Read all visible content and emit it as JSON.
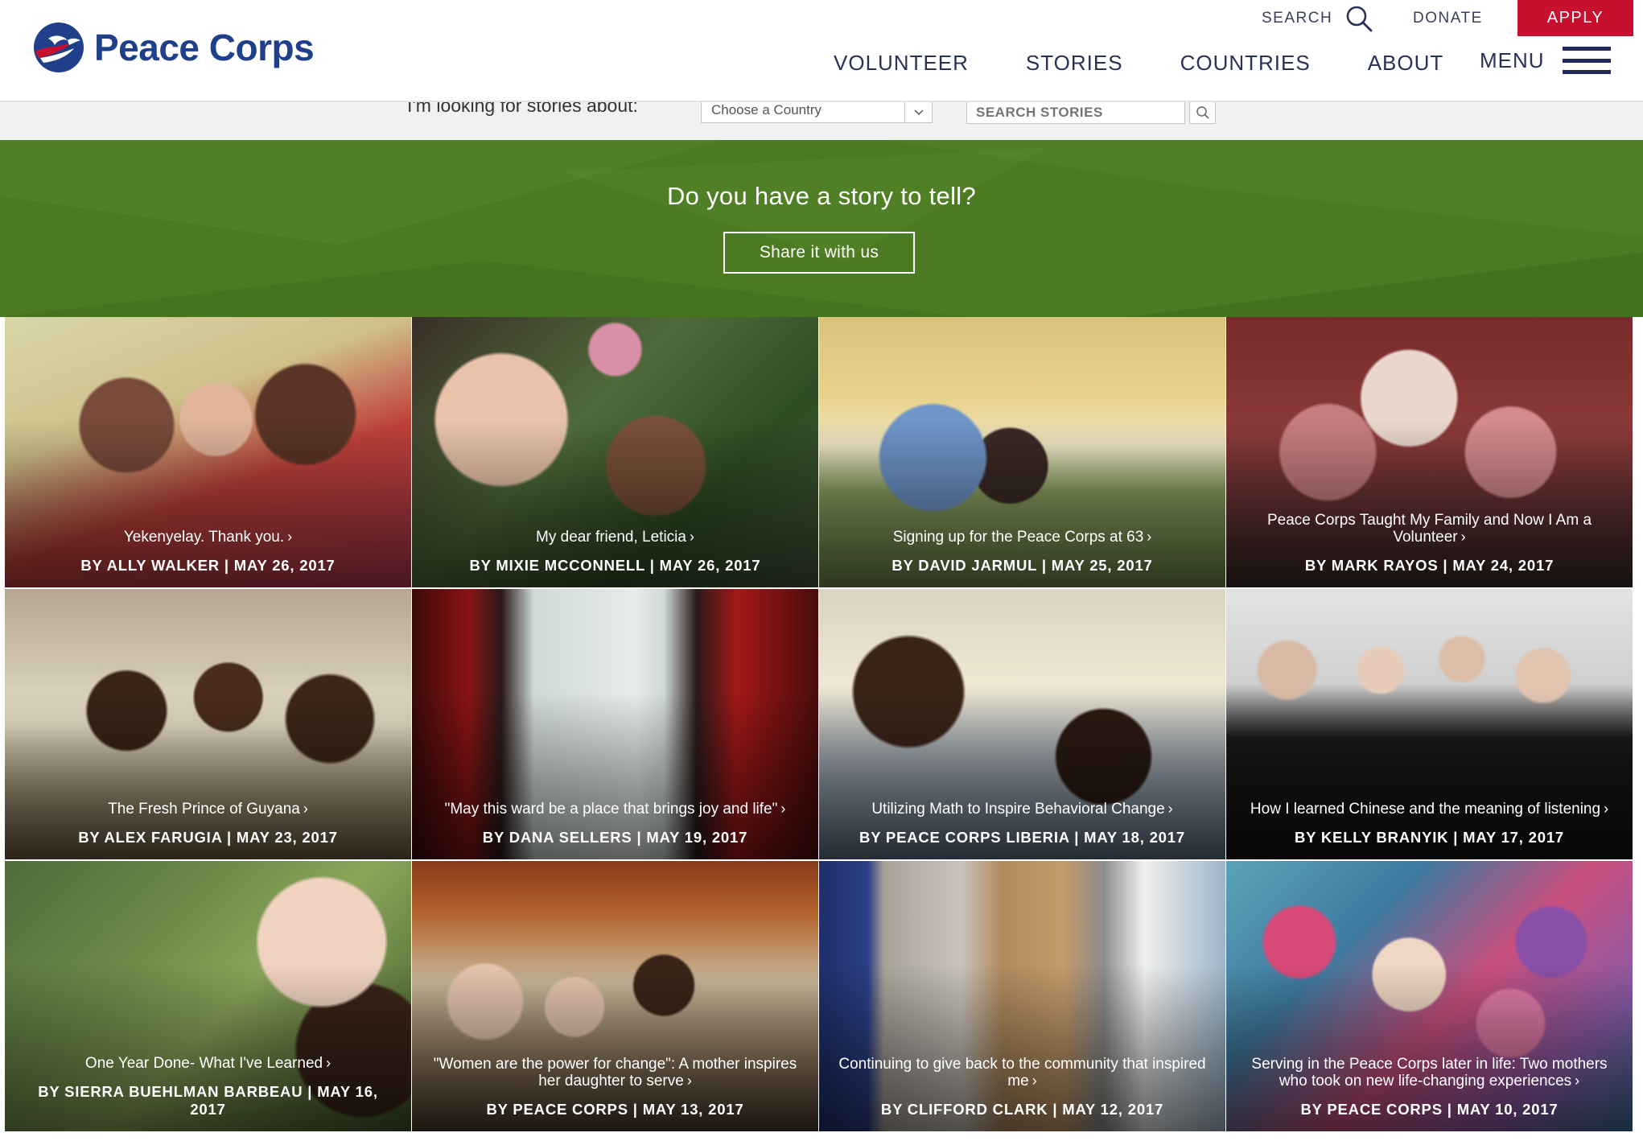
{
  "brand": {
    "name": "Peace Corps",
    "logo_icon": "dove-globe-icon",
    "primary_color": "#1f3f8a",
    "accent_color": "#c8102e",
    "cta_color": "#4b7a22"
  },
  "header": {
    "utility": {
      "search": "SEARCH",
      "donate": "DONATE",
      "apply": "APPLY"
    },
    "nav": [
      "VOLUNTEER",
      "STORIES",
      "COUNTRIES",
      "ABOUT"
    ],
    "menu": "MENU"
  },
  "filter": {
    "label": "I'm looking for stories about:",
    "country_select": "Choose a Country",
    "search_placeholder": "SEARCH STORIES"
  },
  "cta": {
    "title": "Do you have a story to tell?",
    "button": "Share it with us"
  },
  "stories": [
    {
      "title": "Yekenyelay. Thank you.",
      "byline": "BY ALLY WALKER | MAY 26, 2017"
    },
    {
      "title": "My dear friend, Leticia",
      "byline": "BY MIXIE MCCONNELL | MAY 26, 2017"
    },
    {
      "title": "Signing up for the Peace Corps at 63",
      "byline": "BY DAVID JARMUL | MAY 25, 2017"
    },
    {
      "title": "Peace Corps Taught My Family and Now I Am a Volunteer",
      "byline": "BY MARK RAYOS | MAY 24, 2017"
    },
    {
      "title": "The Fresh Prince of Guyana",
      "byline": "BY ALEX FARUGIA | MAY 23, 2017"
    },
    {
      "title": "\"May this ward be a place that brings joy and life\"",
      "byline": "BY DANA SELLERS | MAY 19, 2017"
    },
    {
      "title": "Utilizing Math to Inspire Behavioral Change",
      "byline": "BY PEACE CORPS LIBERIA | MAY 18, 2017"
    },
    {
      "title": "How I learned Chinese and the meaning of listening",
      "byline": "BY KELLY BRANYIK | MAY 17, 2017"
    },
    {
      "title": "One Year Done- What I've Learned",
      "byline": "BY SIERRA BUEHLMAN BARBEAU | MAY 16, 2017"
    },
    {
      "title": "\"Women are the power for change\": A mother inspires her daughter to serve",
      "byline": "BY PEACE CORPS | MAY 13, 2017"
    },
    {
      "title": "Continuing to give back to the community that inspired me",
      "byline": "BY CLIFFORD CLARK | MAY 12, 2017"
    },
    {
      "title": "Serving in the Peace Corps later in life: Two mothers who took on new life-changing experiences",
      "byline": "BY PEACE CORPS | MAY 10, 2017"
    }
  ],
  "icons": {
    "search": "search-icon",
    "chevron": "chevron-down-icon",
    "menu": "hamburger-icon",
    "arrow": "chevron-right-icon"
  }
}
